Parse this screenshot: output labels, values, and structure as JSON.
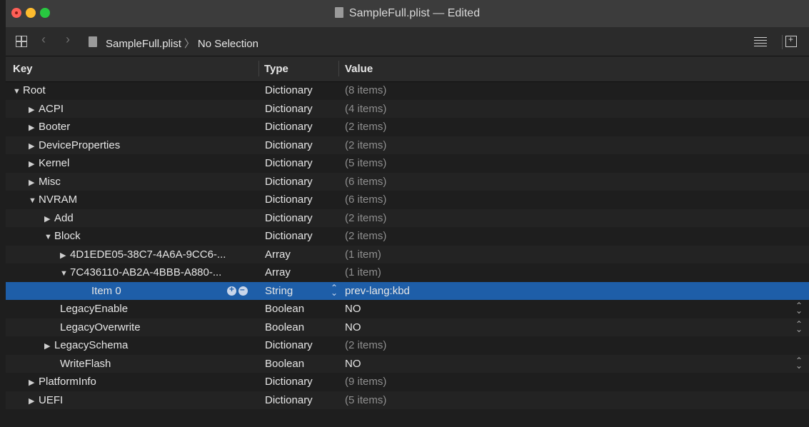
{
  "window": {
    "title": "SampleFull.plist — Edited"
  },
  "toolbar": {
    "breadcrumb_file": "SampleFull.plist",
    "breadcrumb_sep": "〉",
    "breadcrumb_selection": "No Selection"
  },
  "columns": {
    "key": "Key",
    "type": "Type",
    "value": "Value"
  },
  "rows": [
    {
      "key": "Root",
      "type": "Dictionary",
      "value": "(8 items)",
      "indent": 0,
      "disclosure": "expanded"
    },
    {
      "key": "ACPI",
      "type": "Dictionary",
      "value": "(4 items)",
      "indent": 1,
      "disclosure": "collapsed"
    },
    {
      "key": "Booter",
      "type": "Dictionary",
      "value": "(2 items)",
      "indent": 1,
      "disclosure": "collapsed"
    },
    {
      "key": "DeviceProperties",
      "type": "Dictionary",
      "value": "(2 items)",
      "indent": 1,
      "disclosure": "collapsed"
    },
    {
      "key": "Kernel",
      "type": "Dictionary",
      "value": "(5 items)",
      "indent": 1,
      "disclosure": "collapsed"
    },
    {
      "key": "Misc",
      "type": "Dictionary",
      "value": "(6 items)",
      "indent": 1,
      "disclosure": "collapsed"
    },
    {
      "key": "NVRAM",
      "type": "Dictionary",
      "value": "(6 items)",
      "indent": 1,
      "disclosure": "expanded"
    },
    {
      "key": "Add",
      "type": "Dictionary",
      "value": "(2 items)",
      "indent": 2,
      "disclosure": "collapsed"
    },
    {
      "key": "Block",
      "type": "Dictionary",
      "value": "(2 items)",
      "indent": 2,
      "disclosure": "expanded"
    },
    {
      "key": "4D1EDE05-38C7-4A6A-9CC6-...",
      "type": "Array",
      "value": "(1 item)",
      "indent": 3,
      "disclosure": "collapsed"
    },
    {
      "key": "7C436110-AB2A-4BBB-A880-...",
      "type": "Array",
      "value": "(1 item)",
      "indent": 3,
      "disclosure": "expanded"
    },
    {
      "key": "Item 0",
      "type": "String",
      "value": "prev-lang:kbd",
      "indent": 5,
      "disclosure": "none",
      "selected": true
    },
    {
      "key": "LegacyEnable",
      "type": "Boolean",
      "value": "NO",
      "indent": 3,
      "disclosure": "none",
      "stepper": true
    },
    {
      "key": "LegacyOverwrite",
      "type": "Boolean",
      "value": "NO",
      "indent": 3,
      "disclosure": "none",
      "stepper": true
    },
    {
      "key": "LegacySchema",
      "type": "Dictionary",
      "value": "(2 items)",
      "indent": 2,
      "disclosure": "collapsed"
    },
    {
      "key": "WriteFlash",
      "type": "Boolean",
      "value": "NO",
      "indent": 3,
      "disclosure": "none",
      "stepper": true
    },
    {
      "key": "PlatformInfo",
      "type": "Dictionary",
      "value": "(9 items)",
      "indent": 1,
      "disclosure": "collapsed"
    },
    {
      "key": "UEFI",
      "type": "Dictionary",
      "value": "(5 items)",
      "indent": 1,
      "disclosure": "collapsed"
    }
  ],
  "colors": {
    "selection": "#1e5ea8",
    "close": "#fe5f57",
    "minimize": "#febc2e",
    "zoom": "#28c840"
  }
}
